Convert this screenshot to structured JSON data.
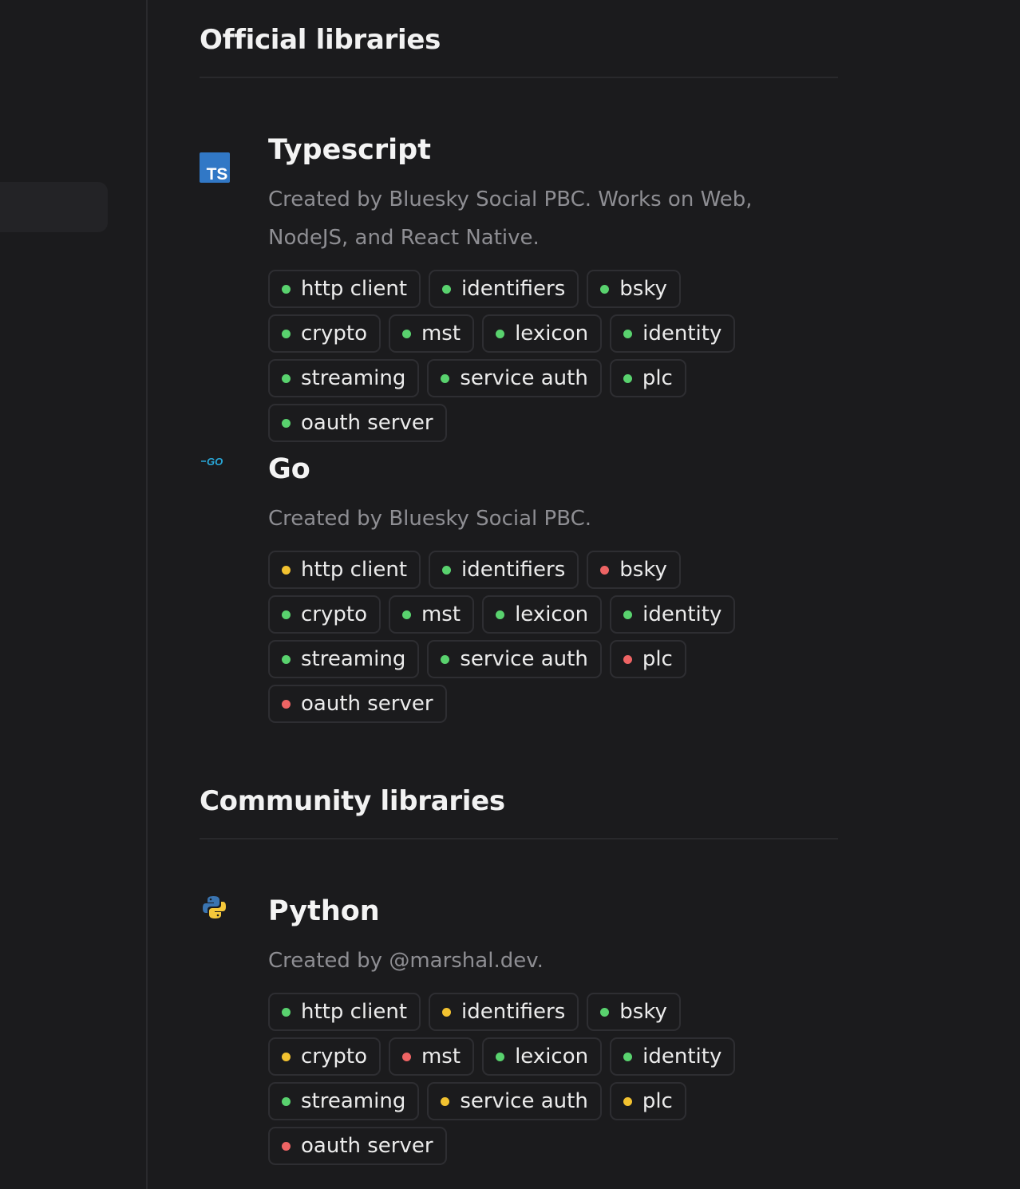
{
  "colors": {
    "green": "#59d26e",
    "yellow": "#f2c230",
    "red": "#ee6464"
  },
  "official": {
    "heading": "Official libraries",
    "libraries": [
      {
        "name": "Typescript",
        "icon": "typescript-icon",
        "icon_text": "TS",
        "description": "Created by Bluesky Social PBC. Works on Web, NodeJS, and React Native.",
        "tags": [
          {
            "label": "http client",
            "status": "green"
          },
          {
            "label": "identifiers",
            "status": "green"
          },
          {
            "label": "bsky",
            "status": "green"
          },
          {
            "label": "crypto",
            "status": "green"
          },
          {
            "label": "mst",
            "status": "green"
          },
          {
            "label": "lexicon",
            "status": "green"
          },
          {
            "label": "identity",
            "status": "green"
          },
          {
            "label": "streaming",
            "status": "green"
          },
          {
            "label": "service auth",
            "status": "green"
          },
          {
            "label": "plc",
            "status": "green"
          },
          {
            "label": "oauth server",
            "status": "green"
          }
        ]
      },
      {
        "name": "Go",
        "icon": "go-icon",
        "icon_text": "GO",
        "description": "Created by Bluesky Social PBC.",
        "tags": [
          {
            "label": "http client",
            "status": "yellow"
          },
          {
            "label": "identifiers",
            "status": "green"
          },
          {
            "label": "bsky",
            "status": "red"
          },
          {
            "label": "crypto",
            "status": "green"
          },
          {
            "label": "mst",
            "status": "green"
          },
          {
            "label": "lexicon",
            "status": "green"
          },
          {
            "label": "identity",
            "status": "green"
          },
          {
            "label": "streaming",
            "status": "green"
          },
          {
            "label": "service auth",
            "status": "green"
          },
          {
            "label": "plc",
            "status": "red"
          },
          {
            "label": "oauth server",
            "status": "red"
          }
        ]
      }
    ]
  },
  "community": {
    "heading": "Community libraries",
    "libraries": [
      {
        "name": "Python",
        "icon": "python-icon",
        "description": "Created by @marshal.dev.",
        "tags": [
          {
            "label": "http client",
            "status": "green"
          },
          {
            "label": "identifiers",
            "status": "yellow"
          },
          {
            "label": "bsky",
            "status": "green"
          },
          {
            "label": "crypto",
            "status": "yellow"
          },
          {
            "label": "mst",
            "status": "red"
          },
          {
            "label": "lexicon",
            "status": "green"
          },
          {
            "label": "identity",
            "status": "green"
          },
          {
            "label": "streaming",
            "status": "green"
          },
          {
            "label": "service auth",
            "status": "yellow"
          },
          {
            "label": "plc",
            "status": "yellow"
          },
          {
            "label": "oauth server",
            "status": "red"
          }
        ]
      }
    ]
  }
}
